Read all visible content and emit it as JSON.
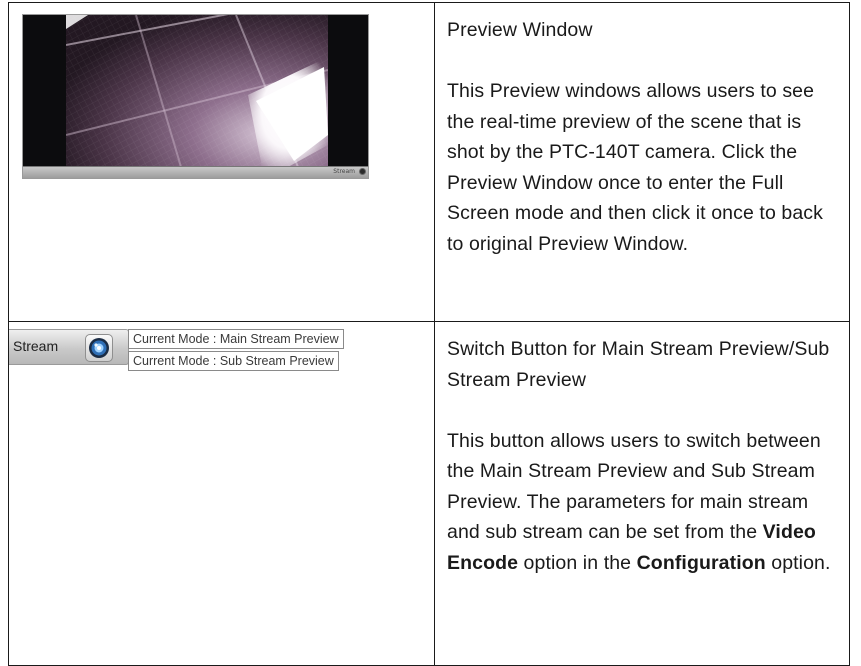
{
  "rows": [
    {
      "title": "Preview Window",
      "description": "This Preview windows allows users to see the real-time preview of the scene that is shot by the PTC-140T camera. Click the Preview Window once to enter the Full Screen mode and then click it once to back to original Preview Window.",
      "image": {
        "kind": "camera-preview",
        "bar_text": "Stream"
      }
    },
    {
      "title": "Switch Button for Main Stream Preview/Sub Stream Preview",
      "description_parts": [
        {
          "text": "This button allows users to switch between the Main Stream Preview and Sub Stream Preview. The parameters for main stream and sub stream can be set from the ",
          "bold": false
        },
        {
          "text": "Video Encode",
          "bold": true
        },
        {
          "text": " option in the ",
          "bold": false
        },
        {
          "text": "Configuration",
          "bold": true
        },
        {
          "text": " option.",
          "bold": false
        }
      ],
      "widget": {
        "label": "Stream",
        "icon": "camera-lens-icon",
        "tooltip_main": "Current Mode : Main Stream Preview",
        "tooltip_sub": "Current Mode : Sub Stream Preview"
      }
    }
  ]
}
